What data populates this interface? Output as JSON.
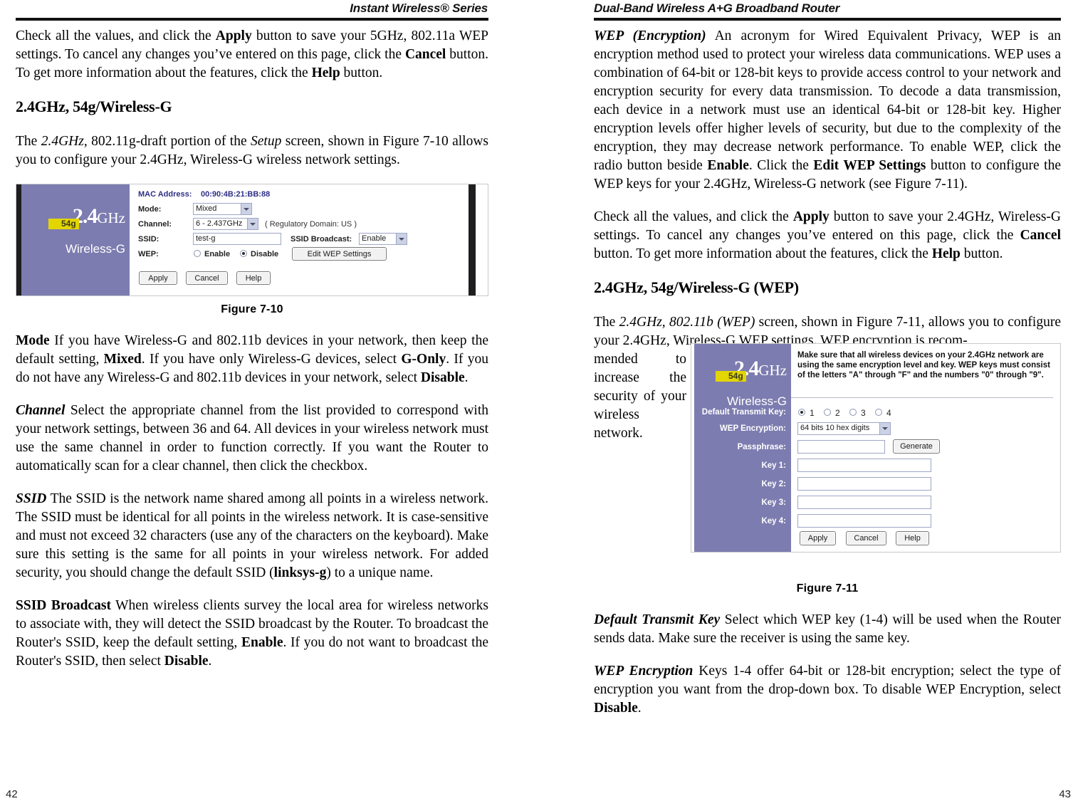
{
  "left_page": {
    "running_head": "Instant Wireless® Series",
    "folio": "42",
    "paragraphs": {
      "p1_a": "Check all the values, and click the ",
      "p1_apply": "Apply",
      "p1_b": " button to save your 5GHz, 802.11a WEP settings. To cancel any changes you’ve entered on this page, click the ",
      "p1_cancel": "Cancel",
      "p1_c": " button. To get more information about the features, click the ",
      "p1_help": "Help",
      "p1_d": " button.",
      "heading": "2.4GHz, 54g/Wireless-G",
      "p2_a": "The ",
      "p2_i1": "2.4GHz,",
      "p2_b": " 802.11g-draft portion of the ",
      "p2_i2": "Setup",
      "p2_c": " screen, shown in Figure 7-10 allows you to configure your 2.4GHz, Wireless-G wireless network settings.",
      "fig_caption": "Figure 7-10",
      "mode_term": "Mode",
      "mode_a": "  If you have Wireless-G and 802.11b devices in your network, then keep the default setting, ",
      "mode_mixed": "Mixed",
      "mode_b": ". If you have only Wireless-G devices, select ",
      "mode_gonly": "G-Only",
      "mode_c": ". If you do not have any Wireless-G and 802.11b devices in your network, select ",
      "mode_disable": "Disable",
      "mode_d": ".",
      "channel_term": "Channel",
      "channel_body": "  Select the appropriate channel from the list provided to correspond with your network settings, between 36 and 64. All devices in your wireless network must use the same channel in order to function correctly. If you want the Router to automatically scan for a clear channel, then click the checkbox.",
      "ssid_term": "SSID",
      "ssid_a": "  The SSID is the network name shared among all points in a wireless network. The SSID must be identical for all points in the wireless network. It is case-sensitive and must not exceed 32 characters (use any of the characters on the keyboard). Make sure this setting is the same for all points in your wireless network. For added security, you should change the default SSID (",
      "ssid_linksys": "linksys-g",
      "ssid_b": ") to a unique name.",
      "broadcast_term": "SSID Broadcast",
      "broadcast_a": "  When wireless clients survey the local area for wireless networks to associate with, they will detect the SSID broadcast by the Router. To broadcast the Router's SSID, keep the default setting, ",
      "broadcast_enable": "Enable",
      "broadcast_b": ". If you do not want to broadcast the Router's SSID, then select ",
      "broadcast_disable": "Disable",
      "broadcast_c": "."
    }
  },
  "right_page": {
    "running_head": "Dual-Band Wireless A+G Broadband Router",
    "folio": "43",
    "paragraphs": {
      "wep_term": "WEP (Encryption)",
      "wep_a": "  An acronym for Wired Equivalent Privacy, WEP is an encryption method used to protect your wireless data communications. WEP uses a combination of 64-bit or 128-bit keys to provide access control to your network and encryption security for every data transmission. To decode a data transmission, each device in a network must use an identical 64-bit or 128-bit key. Higher encryption levels offer higher levels of security, but due to the complexity of the encryption, they may decrease network performance. To enable WEP, click the radio button beside ",
      "wep_enable": "Enable",
      "wep_b": ". Click the ",
      "wep_edit": "Edit WEP Settings",
      "wep_c": " button to configure the WEP keys for your 2.4GHz, Wireless-G network (see Figure 7-11).",
      "p2_a": "Check all the values, and click the ",
      "p2_apply": "Apply",
      "p2_b": " button to save your 2.4GHz, Wireless-G settings. To cancel any changes you’ve entered on this page, click the ",
      "p2_cancel": "Cancel",
      "p2_c": " button. To get more information about the features, click the ",
      "p2_help": "Help",
      "p2_d": " button.",
      "heading": "2.4GHz, 54g/Wireless-G (WEP)",
      "p3_a": "The ",
      "p3_i": "2.4GHz, 802.11b (WEP)",
      "p3_b": " screen, shown in Figure 7-11, allows you to configure your 2.4GHz, Wireless-G WEP settings. WEP encryption is recom-",
      "p3_wrap": "mended to increase the security of your wireless network.",
      "fig_caption": "Figure 7-11",
      "dtk_term": "Default Transmit Key",
      "dtk_body": "  Select which WEP key (1-4) will be used when the Router sends data. Make sure the receiver is using the same key.",
      "enc_term": "WEP Encryption",
      "enc_a": "  Keys 1-4 offer 64-bit or 128-bit encryption; select the type of encryption you want from the drop-down box. To disable WEP Encryption, select ",
      "enc_disable": "Disable",
      "enc_b": "."
    }
  },
  "figure_7_10": {
    "brand": {
      "num": "2.4",
      "ghz": "GHz",
      "badge": "54g",
      "name": "Wireless-G"
    },
    "fields": {
      "mac_label": "MAC Address:",
      "mac_value": "00:90:4B:21:BB:88",
      "mode_label": "Mode:",
      "mode_value": "Mixed",
      "channel_label": "Channel:",
      "channel_value": "6 - 2.437GHz",
      "regulatory": "( Regulatory Domain: US )",
      "ssid_label": "SSID:",
      "ssid_value": "test-g",
      "ssid_broadcast_label": "SSID Broadcast:",
      "ssid_broadcast_value": "Enable",
      "wep_label": "WEP:",
      "wep_enable": "Enable",
      "wep_disable": "Disable",
      "edit_wep": "Edit WEP Settings"
    },
    "buttons": {
      "apply": "Apply",
      "cancel": "Cancel",
      "help": "Help"
    }
  },
  "figure_7_11": {
    "brand": {
      "num": "2.4",
      "ghz": "GHz",
      "badge": "54g",
      "name": "Wireless-G"
    },
    "notice_line1": "Make sure that all wireless devices on your 2.4GHz network are",
    "notice_line2": "using the same encryption level and key. WEP keys must consist",
    "notice_line3": "of the letters \"A\" through \"F\" and the numbers \"0\" through \"9\".",
    "fields": {
      "dtk_label": "Default Transmit Key:",
      "dtk_options": [
        "1",
        "2",
        "3",
        "4"
      ],
      "dtk_selected": "1",
      "enc_label": "WEP Encryption:",
      "enc_value": "64 bits 10 hex digits",
      "pass_label": "Passphrase:",
      "pass_value": "",
      "generate": "Generate",
      "key1_label": "Key 1:",
      "key1_value": "",
      "key2_label": "Key 2:",
      "key2_value": "",
      "key3_label": "Key 3:",
      "key3_value": "",
      "key4_label": "Key 4:",
      "key4_value": ""
    },
    "buttons": {
      "apply": "Apply",
      "cancel": "Cancel",
      "help": "Help"
    }
  },
  "colors": {
    "brand_purple": "#7d7cb0",
    "badge_yellow": "#e3d500",
    "mac_blue": "#2f2f86",
    "field_border": "#9ea6c4",
    "dark_bar": "#1e1e20"
  }
}
